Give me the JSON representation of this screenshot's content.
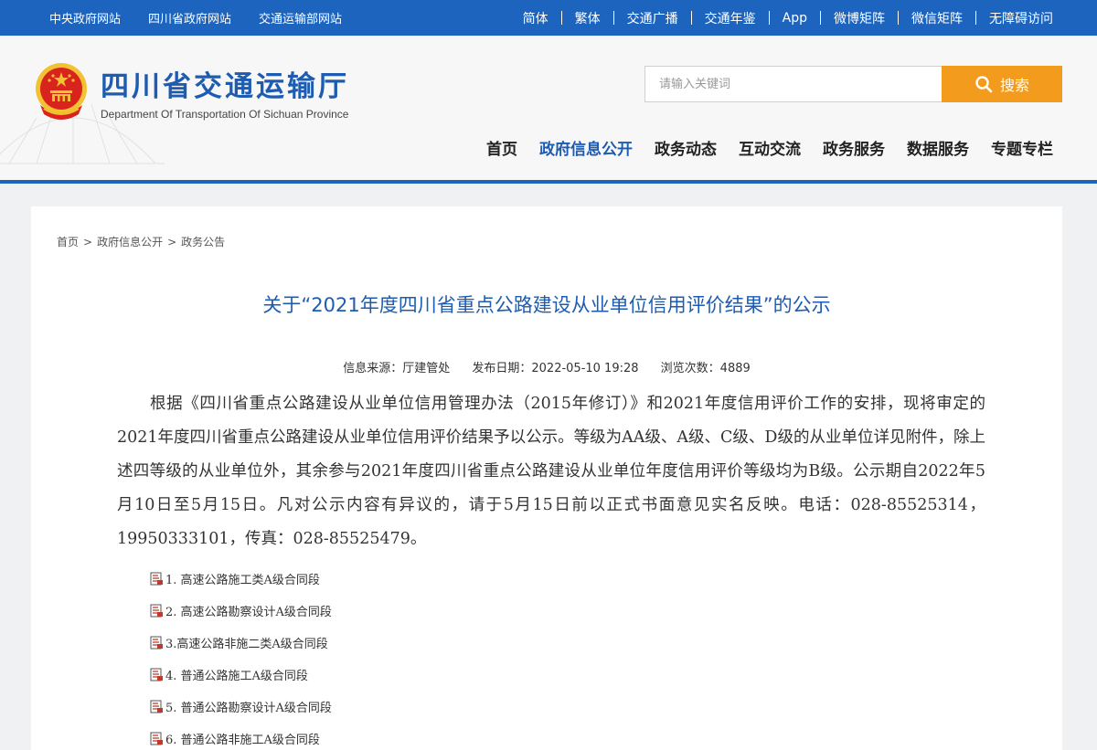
{
  "topbar": {
    "left_links": [
      "中央政府网站",
      "四川省政府网站",
      "交通运输部网站"
    ],
    "right_links": [
      "简体",
      "繁体",
      "交通广播",
      "交通年鉴",
      "App",
      "微博矩阵",
      "微信矩阵",
      "无障碍访问"
    ]
  },
  "header": {
    "title": "四川省交通运输厅",
    "subtitle": "Department Of Transportation Of Sichuan Province",
    "search_placeholder": "请输入关键词",
    "search_label": "搜索",
    "nav": [
      "首页",
      "政府信息公开",
      "政务动态",
      "互动交流",
      "政务服务",
      "数据服务",
      "专题专栏"
    ],
    "active_nav": 1
  },
  "breadcrumb": [
    "首页",
    "政府信息公开",
    "政务公告"
  ],
  "article": {
    "title": "关于“2021年度四川省重点公路建设从业单位信用评价结果”的公示",
    "source_label": "信息来源：厅建管处",
    "date_label": "发布日期：2022-05-10 19:28",
    "views_label": "浏览次数：4889",
    "body": "根据《四川省重点公路建设从业单位信用管理办法（2015年修订）》和2021年度信用评价工作的安排，现将审定的2021年度四川省重点公路建设从业单位信用评价结果予以公示。等级为AA级、A级、C级、D级的从业单位详见附件，除上述四等级的从业单位外，其余参与2021年度四川省重点公路建设从业单位年度信用评价等级均为B级。公示期自2022年5月10日至5月15日。凡对公示内容有异议的，请于5月15日前以正式书面意见实名反映。电话：028-85525314，19950333101，传真：028-85525479。",
    "attachments": [
      "1. 高速公路施工类A级合同段",
      "2. 高速公路勘察设计A级合同段",
      "3.高速公路非施二类A级合同段",
      "4. 普通公路施工A级合同段",
      "5. 普通公路勘察设计A级合同段",
      "6. 普通公路非施工A级合同段"
    ]
  },
  "colors": {
    "brand_blue": "#1d64bf",
    "title_blue": "#1d5cb1",
    "search_orange": "#f29b1d",
    "emblem_red": "#d8241c",
    "emblem_gold": "#f2c232"
  },
  "icons": [
    "national-emblem-icon",
    "search-icon",
    "file-icon"
  ]
}
